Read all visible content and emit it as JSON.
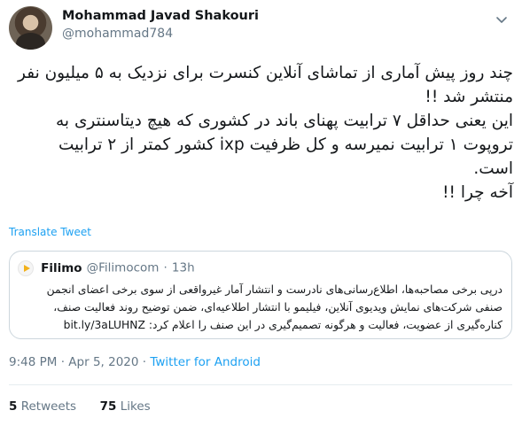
{
  "author": {
    "display_name": "Mohammad Javad Shakouri",
    "handle": "@mohammad784",
    "avatar_icon": "profile-photo"
  },
  "tweet": {
    "lines": [
      "چند روز پیش آماری از تماشای آنلاین کنسرت برای نزدیک به ۵ میلیون نفر",
      "منتشر شد !!",
      "این یعنی حداقل ۷ ترابیت پهنای باند در کشوری که هیچ دیتاسنتری به",
      "تروپوت ۱ ترابیت نمیرسه و کل ظرفیت ixp  کشور کمتر از ۲ ترابیت",
      "است.",
      "آخه چرا !!"
    ],
    "translate_label": "Translate Tweet"
  },
  "quoted": {
    "name": "Filimo",
    "handle": "@Filimocom",
    "separator": "·",
    "time": "13h",
    "lines": [
      "درپی برخی مصاحبه‌ها، اطلاع‌رسانی‌های نادرست و انتشار آمار غیرواقعی از سوی برخی اعضای انجمن",
      "صنفی شرکت‌های نمایش ویدیوی آنلاین، فیلیمو با انتشار اطلاعیه‌ای، ضمن توضیح روند فعالیت صنف،",
      "کناره‌گیری از عضویت، فعالیت و هرگونه تصمیم‌گیری در این صنف را اعلام کرد: bit.ly/3aLUHNZ"
    ]
  },
  "meta": {
    "time": "9:48 PM",
    "separator": "·",
    "date": "Apr 5, 2020",
    "source": "Twitter for Android"
  },
  "stats": {
    "retweets_count": "5",
    "retweets_label": "Retweets",
    "likes_count": "75",
    "likes_label": "Likes"
  },
  "colors": {
    "link": "#1da1f2",
    "secondary_text": "#657786",
    "border": "#ccd6dd"
  }
}
